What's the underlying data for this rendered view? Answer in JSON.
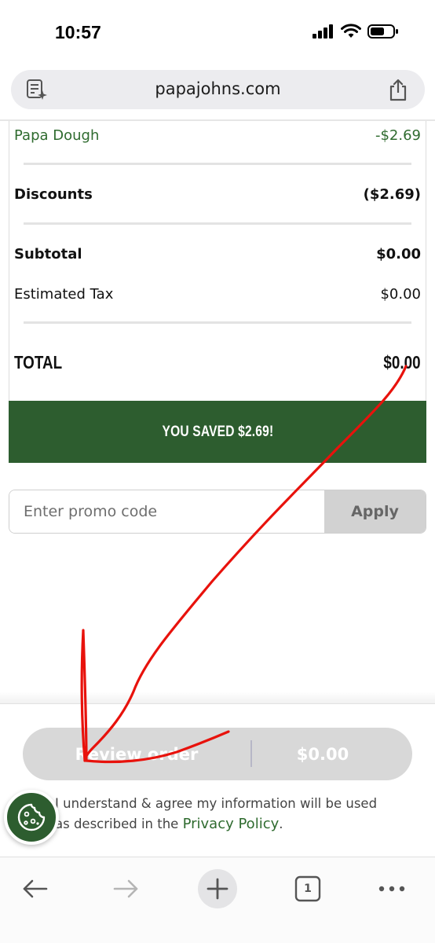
{
  "status_bar": {
    "time": "10:57"
  },
  "browser": {
    "url": "papajohns.com",
    "tab_count": "1"
  },
  "order_summary": {
    "discount_item": {
      "label": "Papa Dough",
      "amount": "-$2.69"
    },
    "discounts": {
      "label": "Discounts",
      "amount": "($2.69)"
    },
    "subtotal": {
      "label": "Subtotal",
      "amount": "$0.00"
    },
    "tax": {
      "label": "Estimated Tax",
      "amount": "$0.00"
    },
    "total": {
      "label": "TOTAL",
      "amount": "$0.00"
    },
    "savings_banner": "YOU SAVED $2.69!"
  },
  "promo": {
    "placeholder": "Enter promo code",
    "value": "",
    "apply_label": "Apply"
  },
  "review": {
    "button_label": "Review order",
    "price": "$0.00"
  },
  "consent": {
    "text": "I understand & agree my information will be used as described in the ",
    "link_label": "Privacy Policy",
    "suffix": "."
  },
  "colors": {
    "brand_green": "#2d5d2f",
    "discount_green": "#2f6b2f",
    "annotation_red": "#e8120c",
    "disabled_gray": "#d8d8d8"
  },
  "icons": {
    "reader": "reader-mode-icon",
    "share": "share-icon",
    "back": "back-arrow-icon",
    "forward": "forward-arrow-icon",
    "new_tab": "plus-icon",
    "tabs": "tabs-icon",
    "more": "more-icon",
    "cookie": "cookie-icon"
  }
}
